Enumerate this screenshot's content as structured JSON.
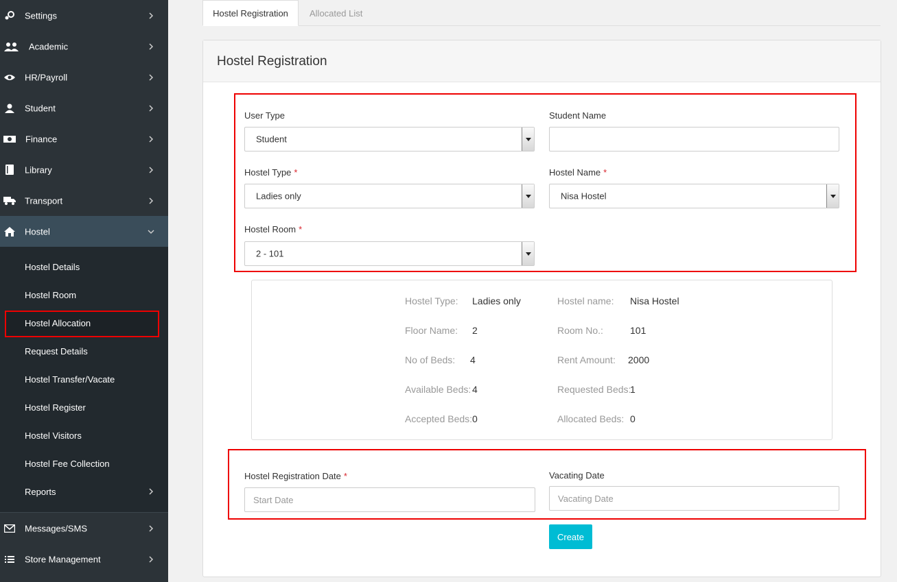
{
  "sidebar": {
    "items": [
      {
        "label": "Settings",
        "icon": "gears-icon"
      },
      {
        "label": "Academic",
        "icon": "users-icon"
      },
      {
        "label": "HR/Payroll",
        "icon": "eye-icon"
      },
      {
        "label": "Student",
        "icon": "user-icon"
      },
      {
        "label": "Finance",
        "icon": "money-icon"
      },
      {
        "label": "Library",
        "icon": "book-icon"
      },
      {
        "label": "Transport",
        "icon": "truck-icon"
      },
      {
        "label": "Hostel",
        "icon": "home-icon"
      }
    ],
    "hostel_sub": [
      "Hostel Details",
      "Hostel Room",
      "Hostel Allocation",
      "Request Details",
      "Hostel Transfer/Vacate",
      "Hostel Register",
      "Hostel Visitors",
      "Hostel Fee Collection",
      "Reports"
    ],
    "bottom_items": [
      {
        "label": "Messages/SMS",
        "icon": "envelope-icon"
      },
      {
        "label": "Store Management",
        "icon": "list-icon"
      }
    ]
  },
  "tabs": {
    "active": "Hostel Registration",
    "inactive": "Allocated List"
  },
  "panel": {
    "title": "Hostel Registration"
  },
  "form": {
    "user_type_label": "User Type",
    "user_type_value": "Student",
    "student_name_label": "Student Name",
    "student_name_value": "",
    "hostel_type_label": "Hostel Type",
    "hostel_type_value": "Ladies only",
    "hostel_name_label": "Hostel Name",
    "hostel_name_value": "Nisa Hostel",
    "hostel_room_label": "Hostel Room",
    "hostel_room_value": "2 - 101",
    "required_mark": "*",
    "reg_date_label": "Hostel Registration Date",
    "reg_date_placeholder": "Start Date",
    "vacate_date_label": "Vacating Date",
    "vacate_date_placeholder": "Vacating Date",
    "create_label": "Create"
  },
  "info": {
    "hostel_type_k": "Hostel Type:",
    "hostel_type_v": "Ladies only",
    "hostel_name_k": "Hostel name:",
    "hostel_name_v": "Nisa Hostel",
    "floor_k": "Floor Name:",
    "floor_v": "2",
    "room_k": "Room No.:",
    "room_v": "101",
    "beds_k": "No of Beds:",
    "beds_v": "4",
    "rent_k": "Rent Amount:",
    "rent_v": "2000",
    "avail_k": "Available Beds:",
    "avail_v": "4",
    "requested_k": "Requested Beds:",
    "requested_v": "1",
    "accepted_k": "Accepted Beds:",
    "accepted_v": "0",
    "allocated_k": "Allocated Beds:",
    "allocated_v": "0"
  },
  "colors": {
    "sidebar_bg": "#2c3338",
    "highlight": "#e00000",
    "accent": "#00bcd4"
  }
}
